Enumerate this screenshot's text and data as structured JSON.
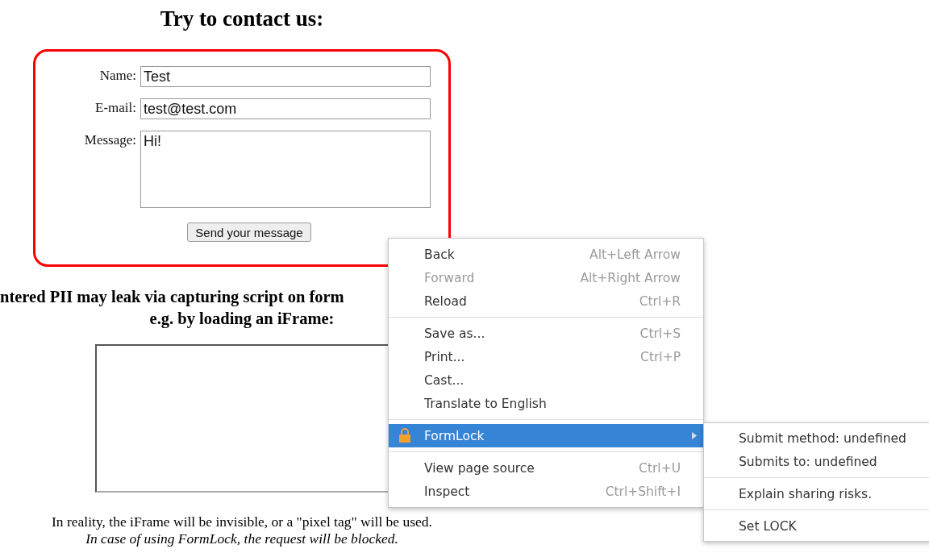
{
  "page": {
    "title": "Try to contact us:",
    "form": {
      "fields": [
        {
          "kind": "input",
          "label": "Name:",
          "value": "Test"
        },
        {
          "kind": "input",
          "label": "E-mail:",
          "value": "test@test.com"
        },
        {
          "kind": "textarea",
          "label": "Message:",
          "value": "Hi!"
        }
      ],
      "button": "Send your message"
    },
    "warning_lines": [
      "ntered PII may leak via capturing script on form",
      "e.g. by loading an iFrame:"
    ],
    "notes": [
      {
        "text": "In reality, the iFrame will be invisible, or a \"pixel tag\" will be used.",
        "italic": false
      },
      {
        "text": "In case of using FormLock, the request will be blocked.",
        "italic": true
      }
    ]
  },
  "context_menu": {
    "groups": [
      [
        {
          "label": "Back",
          "shortcut": "Alt+Left Arrow",
          "disabled": false,
          "selected": false
        },
        {
          "label": "Forward",
          "shortcut": "Alt+Right Arrow",
          "disabled": true,
          "selected": false
        },
        {
          "label": "Reload",
          "shortcut": "Ctrl+R",
          "disabled": false,
          "selected": false
        }
      ],
      [
        {
          "label": "Save as...",
          "shortcut": "Ctrl+S",
          "disabled": false,
          "selected": false
        },
        {
          "label": "Print...",
          "shortcut": "Ctrl+P",
          "disabled": false,
          "selected": false
        },
        {
          "label": "Cast...",
          "disabled": false,
          "selected": false
        },
        {
          "label": "Translate to English",
          "disabled": false,
          "selected": false
        }
      ],
      [
        {
          "label": "FormLock",
          "kind": "submenu",
          "disabled": false,
          "selected": true
        }
      ],
      [
        {
          "label": "View page source",
          "shortcut": "Ctrl+U",
          "disabled": false,
          "selected": false
        },
        {
          "label": "Inspect",
          "shortcut": "Ctrl+Shift+I",
          "disabled": false,
          "selected": false
        }
      ]
    ]
  },
  "submenu": {
    "groups": [
      [
        "Submit method: undefined",
        "Submits to: undefined"
      ],
      [
        "Explain sharing risks."
      ],
      [
        "Set LOCK"
      ]
    ]
  }
}
